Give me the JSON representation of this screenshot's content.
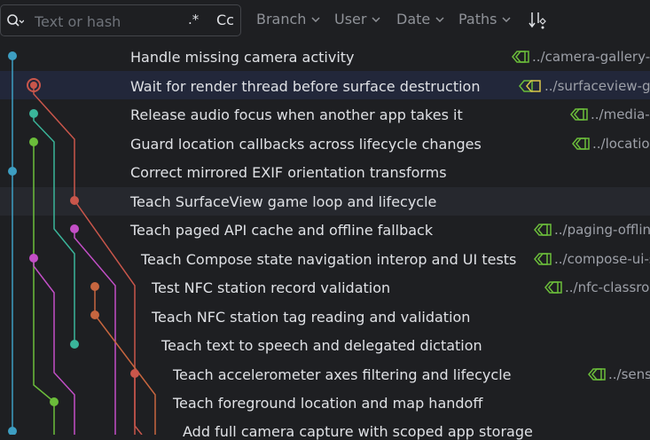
{
  "toolbar": {
    "search_placeholder": "Text or hash",
    "regex_label": ".*",
    "case_label": "Cc",
    "filters": [
      "Branch",
      "User",
      "Date",
      "Paths"
    ]
  },
  "commits": [
    {
      "message": "Handle missing camera activity",
      "ref": "../camera-gallery-s"
    },
    {
      "message": "Wait for render thread before surface destruction",
      "ref": "../surfaceview-ga"
    },
    {
      "message": "Release audio focus when another app takes it",
      "ref": "../media-s"
    },
    {
      "message": "Guard location callbacks across lifecycle changes",
      "ref": "../location"
    },
    {
      "message": "Correct mirrored EXIF orientation transforms",
      "ref": ""
    },
    {
      "message": "Teach SurfaceView game loop and lifecycle",
      "ref": ""
    },
    {
      "message": "Teach paged API cache and offline fallback",
      "ref": "../paging-offline"
    },
    {
      "message": "Teach Compose state navigation interop and UI tests",
      "ref": "../compose-ui-s"
    },
    {
      "message": "Test NFC station record validation",
      "ref": "../nfc-classroo"
    },
    {
      "message": "Teach NFC station tag reading and validation",
      "ref": ""
    },
    {
      "message": "Teach text to speech and delegated dictation",
      "ref": ""
    },
    {
      "message": "Teach accelerometer axes filtering and lifecycle",
      "ref": "../sens"
    },
    {
      "message": "Teach foreground location and map handoff",
      "ref": ""
    },
    {
      "message": "Add full camera capture with scoped app storage",
      "ref": ""
    }
  ],
  "colors": {
    "background": "#1e1f22",
    "selected_row": "#22273a",
    "hover_row": "#26282e",
    "lane_blue": "#3d9ec2",
    "lane_red": "#c9564b",
    "lane_teal": "#3ab59a",
    "lane_green": "#6bbd3a",
    "lane_magenta": "#c34fc7",
    "lane_orange": "#c7663f",
    "tag_green": "#6bbd3a",
    "tag_yellow": "#d9c649"
  }
}
